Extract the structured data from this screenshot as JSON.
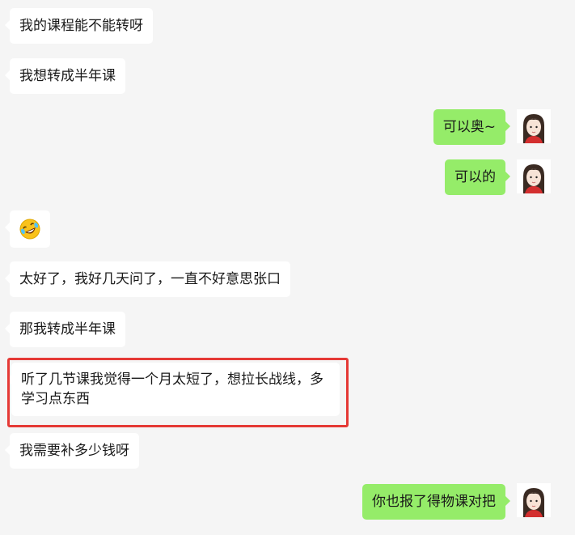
{
  "messages": [
    {
      "side": "in",
      "text": "我的课程能不能转呀"
    },
    {
      "side": "in",
      "text": "我想转成半年课"
    },
    {
      "side": "out",
      "text": "可以奥~"
    },
    {
      "side": "out",
      "text": "可以的"
    },
    {
      "side": "in",
      "emoji": "laughing-crying-emoji"
    },
    {
      "side": "in",
      "text": "太好了，我好几天问了，一直不好意思张口"
    },
    {
      "side": "in",
      "text": "那我转成半年课"
    },
    {
      "side": "in",
      "text": "听了几节课我觉得一个月太短了，想拉长战线，多学习点东西",
      "highlighted": true
    },
    {
      "side": "in",
      "text": "我需要补多少钱呀"
    },
    {
      "side": "out",
      "text": "你也报了得物课对把"
    }
  ],
  "colors": {
    "background": "#f5f5f5",
    "incoming_bubble": "#ffffff",
    "outgoing_bubble": "#95ec69",
    "highlight_border": "#e53935"
  }
}
